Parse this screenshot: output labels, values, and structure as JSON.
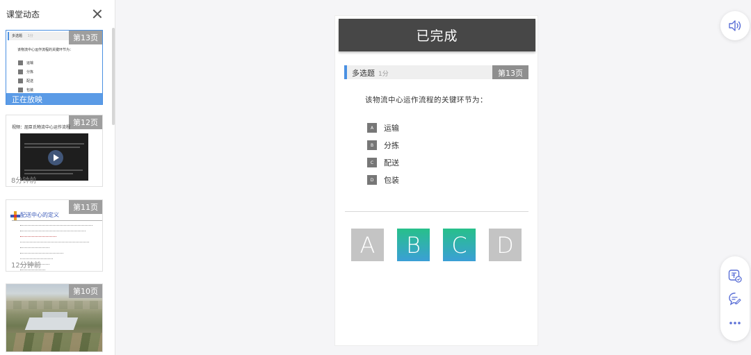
{
  "sidebar": {
    "title": "课堂动态",
    "slides": [
      {
        "page": "第13页",
        "status": "正在放映",
        "preview_type": "多选题",
        "preview_score": "1分",
        "preview_question": "该物流中心运作流程的关键环节为：",
        "preview_options": [
          "运输",
          "分拣",
          "配送",
          "包装"
        ]
      },
      {
        "page": "第12页",
        "title": "视频：屈臣氏物流中心运作流程",
        "duration": "8分钟前"
      },
      {
        "page": "第11页",
        "title": "配送中心的定义",
        "duration": "12分钟前"
      },
      {
        "page": "第10页"
      }
    ]
  },
  "slide": {
    "status_banner": "已完成",
    "question_type": "多选题",
    "score": "1分",
    "page": "第13页",
    "question": "该物流中心运作流程的关键环节为：",
    "options": [
      {
        "letter": "A",
        "label": "运输"
      },
      {
        "letter": "B",
        "label": "分拣"
      },
      {
        "letter": "C",
        "label": "配送"
      },
      {
        "letter": "D",
        "label": "包装"
      }
    ],
    "answers": [
      {
        "letter": "A",
        "selected": false
      },
      {
        "letter": "B",
        "selected": true
      },
      {
        "letter": "C",
        "selected": true
      },
      {
        "letter": "D",
        "selected": false
      }
    ]
  },
  "controls": {
    "volume_icon": "speaker-icon",
    "danmu_icon": "danmu-icon",
    "comment_icon": "comment-edit-icon",
    "more_icon": "more-dots-icon"
  },
  "colors": {
    "accent": "#4a90e2",
    "selected_gradient_top": "#27c08a",
    "selected_gradient_bottom": "#3b9fd6",
    "unselected": "#c4c4c4",
    "banner": "#474747",
    "page_badge": "#8e8e8e"
  }
}
